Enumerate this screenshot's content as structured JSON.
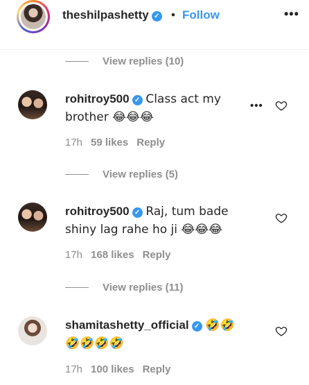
{
  "header": {
    "username": "theshilpashetty",
    "separator": "•",
    "follow_label": "Follow",
    "more_label": "•••"
  },
  "threads": [
    {
      "view_replies": "View replies (10)"
    },
    {
      "view_replies": "View replies (5)"
    },
    {
      "view_replies": "View replies (11)"
    }
  ],
  "comments": [
    {
      "username": "rohitroy500",
      "text": "Class act my brother 😂😂😂",
      "time": "17h",
      "likes": "59 likes",
      "reply": "Reply",
      "more": "•••"
    },
    {
      "username": "rohitroy500",
      "text": "Raj, tum bade shiny lag rahe ho ji 😂😂😂",
      "time": "17h",
      "likes": "168 likes",
      "reply": "Reply"
    },
    {
      "username": "shamitashetty_official",
      "text": "🤣🤣 🤣🤣🤣🤣",
      "time": "17h",
      "likes": "100 likes",
      "reply": "Reply"
    }
  ],
  "icons": {
    "verified": "verified-badge-icon",
    "heart": "heart-outline-icon",
    "more": "more-options-icon"
  },
  "colors": {
    "link": "#3897f0",
    "muted": "#8e8e8e",
    "text": "#262626"
  }
}
